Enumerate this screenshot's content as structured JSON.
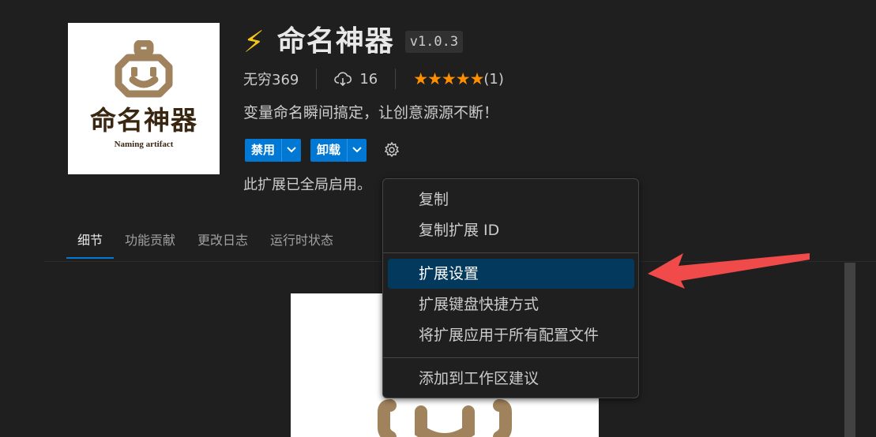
{
  "logo": {
    "title": "命名神器",
    "subtitle": "Naming artifact",
    "icon": "robot-face-icon",
    "brand_color": "#a0835c"
  },
  "extension": {
    "icon": "lightning-bolt-icon",
    "name": "命名神器",
    "version": "v1.0.3",
    "publisher": "无穷369",
    "download_icon": "cloud-download-icon",
    "installs": "16",
    "stars": "★★★★★",
    "rating_count": "(1)",
    "description": "变量命名瞬间搞定，让创意源源不断！",
    "disable_label": "禁用",
    "uninstall_label": "卸载",
    "status": "此扩展已全局启用。"
  },
  "tabs": [
    {
      "label": "细节",
      "active": true
    },
    {
      "label": "功能贡献",
      "active": false
    },
    {
      "label": "更改日志",
      "active": false
    },
    {
      "label": "运行时状态",
      "active": false
    }
  ],
  "context_menu": {
    "items": [
      {
        "label": "复制"
      },
      {
        "label": "复制扩展 ID"
      },
      {
        "label": "扩展设置",
        "highlighted": true
      },
      {
        "label": "扩展键盘快捷方式"
      },
      {
        "label": "将扩展应用于所有配置文件"
      },
      {
        "label": "添加到工作区建议"
      }
    ]
  },
  "colors": {
    "accent": "#0078d4",
    "star": "#ff8e00",
    "menu_highlight": "#04395e",
    "annotation_arrow": "#f04a4a"
  }
}
